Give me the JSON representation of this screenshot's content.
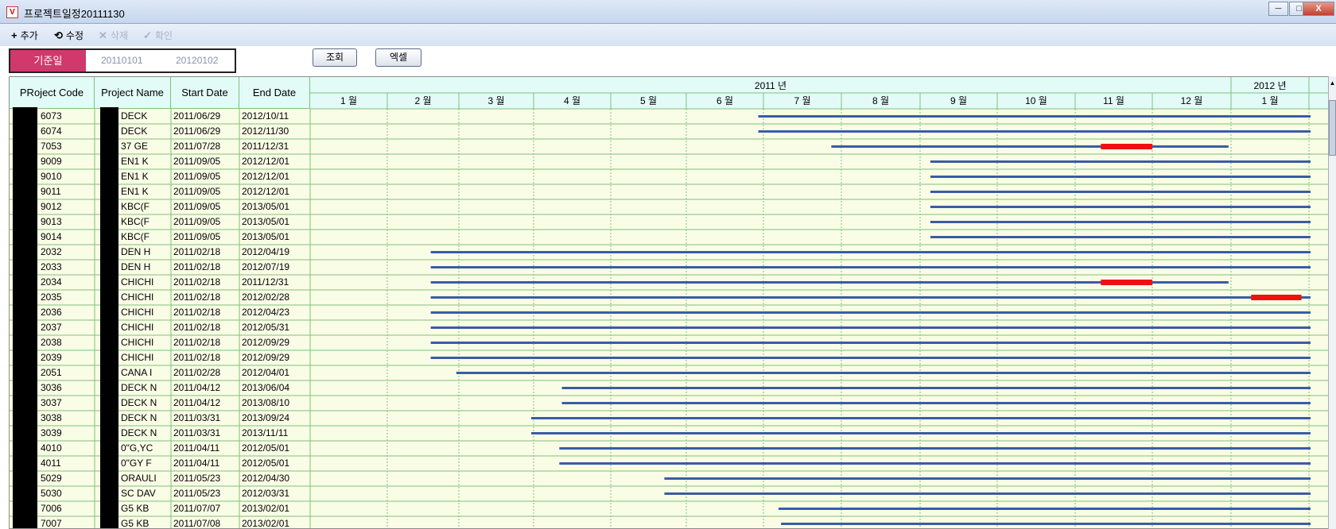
{
  "window": {
    "title": "프로젝트일정20111130",
    "app_icon_letter": "V",
    "minimize_glyph": "─",
    "maximize_glyph": "□",
    "close_glyph": "X"
  },
  "toolbar": {
    "add_label": "추가",
    "edit_label": "수정",
    "delete_label": "삭제",
    "confirm_label": "확인",
    "add_icon": "plus-icon",
    "edit_icon": "refresh-icon",
    "delete_icon": "x-icon",
    "confirm_icon": "check-icon"
  },
  "filter": {
    "basis_label": "기준일",
    "date_from": "20110101",
    "date_to": "20120102",
    "search_label": "조회",
    "excel_label": "엑셀"
  },
  "grid": {
    "headers": {
      "code": "PRoject Code",
      "name": "Project Name",
      "start": "Start Date",
      "end": "End Date"
    },
    "years": [
      {
        "label": "2011 년"
      },
      {
        "label": "2012 년"
      }
    ],
    "months": [
      "1 월",
      "2 월",
      "3 월",
      "4 월",
      "5 월",
      "6 월",
      "7 월",
      "8 월",
      "9 월",
      "10 월",
      "11 월",
      "12 월",
      "1 월"
    ],
    "colors": {
      "bar": "#3a5ca6",
      "overdue": "#ee1111",
      "row_bg": "#fafde6",
      "header_bg": "#e2fbf7",
      "grid_line": "#80c07c"
    },
    "rows": [
      {
        "code": "6073",
        "name": "DECK",
        "start": "2011/06/29",
        "end": "2012/10/11",
        "overdue": null
      },
      {
        "code": "6074",
        "name": "DECK",
        "start": "2011/06/29",
        "end": "2012/11/30",
        "overdue": null
      },
      {
        "code": "7053",
        "name": "37 GE",
        "start": "2011/07/28",
        "end": "2011/12/31",
        "overdue": [
          "2011-11-11",
          "2011-12-01"
        ]
      },
      {
        "code": "9009",
        "name": "EN1 K",
        "start": "2011/09/05",
        "end": "2012/12/01",
        "overdue": null
      },
      {
        "code": "9010",
        "name": "EN1 K",
        "start": "2011/09/05",
        "end": "2012/12/01",
        "overdue": null
      },
      {
        "code": "9011",
        "name": "EN1 K",
        "start": "2011/09/05",
        "end": "2012/12/01",
        "overdue": null
      },
      {
        "code": "9012",
        "name": "KBC(F",
        "start": "2011/09/05",
        "end": "2013/05/01",
        "overdue": null
      },
      {
        "code": "9013",
        "name": "KBC(F",
        "start": "2011/09/05",
        "end": "2013/05/01",
        "overdue": null
      },
      {
        "code": "9014",
        "name": "KBC(F",
        "start": "2011/09/05",
        "end": "2013/05/01",
        "overdue": null
      },
      {
        "code": "2032",
        "name": "DEN H",
        "start": "2011/02/18",
        "end": "2012/04/19",
        "overdue": null
      },
      {
        "code": "2033",
        "name": "DEN H",
        "start": "2011/02/18",
        "end": "2012/07/19",
        "overdue": null
      },
      {
        "code": "2034",
        "name": "CHICHI",
        "start": "2011/02/18",
        "end": "2011/12/31",
        "overdue": [
          "2011-11-11",
          "2011-12-01"
        ]
      },
      {
        "code": "2035",
        "name": "CHICHI",
        "start": "2011/02/18",
        "end": "2012/02/28",
        "overdue": [
          "2012-01-09",
          "2012-01-29"
        ]
      },
      {
        "code": "2036",
        "name": "CHICHI",
        "start": "2011/02/18",
        "end": "2012/04/23",
        "overdue": null
      },
      {
        "code": "2037",
        "name": "CHICHI",
        "start": "2011/02/18",
        "end": "2012/05/31",
        "overdue": null
      },
      {
        "code": "2038",
        "name": "CHICHI",
        "start": "2011/02/18",
        "end": "2012/09/29",
        "overdue": null
      },
      {
        "code": "2039",
        "name": "CHICHI",
        "start": "2011/02/18",
        "end": "2012/09/29",
        "overdue": null
      },
      {
        "code": "2051",
        "name": "CANA I",
        "start": "2011/02/28",
        "end": "2012/04/01",
        "overdue": null
      },
      {
        "code": "3036",
        "name": "DECK N",
        "start": "2011/04/12",
        "end": "2013/06/04",
        "overdue": null
      },
      {
        "code": "3037",
        "name": "DECK N",
        "start": "2011/04/12",
        "end": "2013/08/10",
        "overdue": null
      },
      {
        "code": "3038",
        "name": "DECK N",
        "start": "2011/03/31",
        "end": "2013/09/24",
        "overdue": null
      },
      {
        "code": "3039",
        "name": "DECK N",
        "start": "2011/03/31",
        "end": "2013/11/11",
        "overdue": null
      },
      {
        "code": "4010",
        "name": "0\"G,YC",
        "start": "2011/04/11",
        "end": "2012/05/01",
        "overdue": null
      },
      {
        "code": "4011",
        "name": "0\"GY F",
        "start": "2011/04/11",
        "end": "2012/05/01",
        "overdue": null
      },
      {
        "code": "5029",
        "name": "ORAULI",
        "start": "2011/05/23",
        "end": "2012/04/30",
        "overdue": null
      },
      {
        "code": "5030",
        "name": "SC DAV",
        "start": "2011/05/23",
        "end": "2012/03/31",
        "overdue": null
      },
      {
        "code": "7006",
        "name": "G5 KB",
        "start": "2011/07/07",
        "end": "2013/02/01",
        "overdue": null
      },
      {
        "code": "7007",
        "name": "G5 KB",
        "start": "2011/07/08",
        "end": "2013/02/01",
        "overdue": null
      }
    ]
  }
}
